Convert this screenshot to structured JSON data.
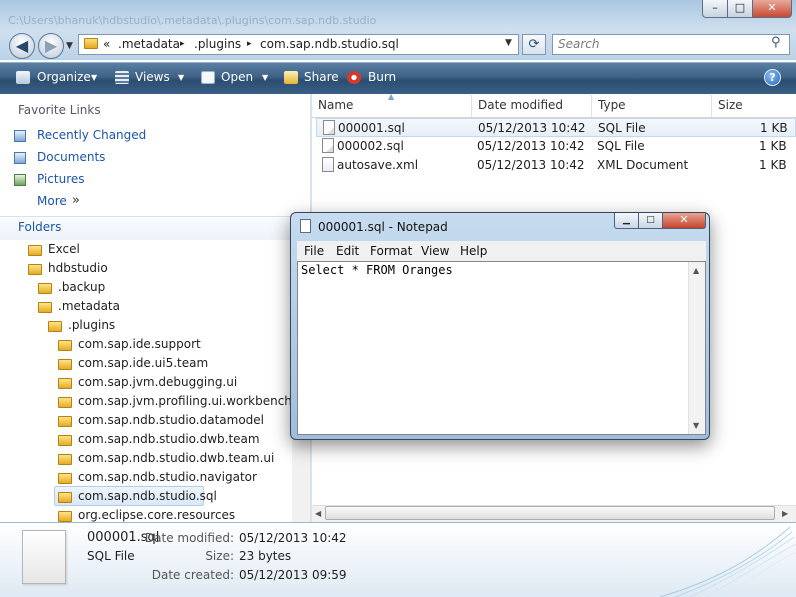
{
  "window": {
    "title_path": "C:\\Users\\bhanuk\\hdbstudio\\.metadata\\.plugins\\com.sap.ndb.studio",
    "controls": {
      "minimize": "–",
      "maximize": "□",
      "close": "✕"
    }
  },
  "address": {
    "breadcrumbs": [
      "«",
      ".metadata",
      "▸",
      ".plugins",
      "▸",
      "com.sap.ndb.studio.sql"
    ],
    "search_placeholder": "Search"
  },
  "toolbar": {
    "organize": "Organize",
    "views": "Views",
    "open": "Open",
    "share": "Share",
    "burn": "Burn"
  },
  "favorites": {
    "title": "Favorite Links",
    "items": [
      "Recently Changed",
      "Documents",
      "Pictures"
    ],
    "more": "More",
    "more_glyph": "»"
  },
  "folders": {
    "title": "Folders",
    "tree": [
      "Excel",
      "hdbstudio",
      ".backup",
      ".metadata",
      ".plugins",
      "com.sap.ide.support",
      "com.sap.ide.ui5.team",
      "com.sap.jvm.debugging.ui",
      "com.sap.jvm.profiling.ui.workbench",
      "com.sap.ndb.studio.datamodel",
      "com.sap.ndb.studio.dwb.team",
      "com.sap.ndb.studio.dwb.team.ui",
      "com.sap.ndb.studio.navigator",
      "com.sap.ndb.studio.sql",
      "org.eclipse.core.resources"
    ],
    "selected": "com.sap.ndb.studio.sql"
  },
  "file_list": {
    "columns": [
      "Name",
      "Date modified",
      "Type",
      "Size"
    ],
    "rows": [
      {
        "name": "000001.sql",
        "date": "05/12/2013 10:42",
        "type": "SQL File",
        "size": "1 KB"
      },
      {
        "name": "000002.sql",
        "date": "05/12/2013 10:42",
        "type": "SQL File",
        "size": "1 KB"
      },
      {
        "name": "autosave.xml",
        "date": "05/12/2013 10:42",
        "type": "XML Document",
        "size": "1 KB"
      }
    ]
  },
  "details": {
    "filename": "000001.sql",
    "filetype": "SQL File",
    "labels": {
      "modified": "Date modified:",
      "size": "Size:",
      "created": "Date created:"
    },
    "values": {
      "modified": "05/12/2013 10:42",
      "size": "23 bytes",
      "created": "05/12/2013 09:59"
    }
  },
  "notepad": {
    "title": "000001.sql - Notepad",
    "menu": [
      "File",
      "Edit",
      "Format",
      "View",
      "Help"
    ],
    "content": "Select * FROM Oranges",
    "controls": {
      "minimize": "▁",
      "maximize": "□",
      "close": "✕"
    }
  },
  "colors": {
    "command_bar": "#3e6186",
    "link": "#1c55a9",
    "selection": "#d9e8f8"
  }
}
